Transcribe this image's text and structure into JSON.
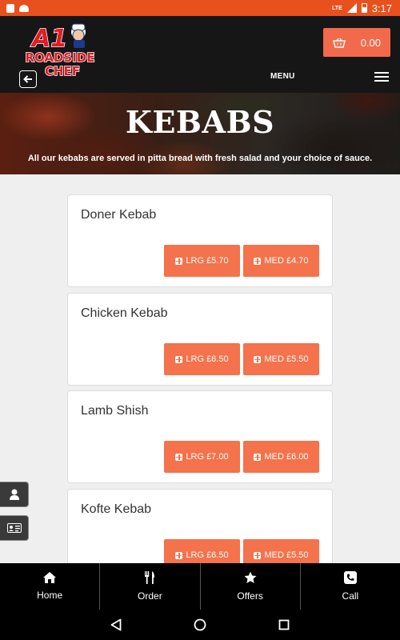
{
  "status_bar": {
    "time": "3:17",
    "network": "LTE"
  },
  "header": {
    "logo_line1": "A1",
    "logo_line2": "ROADSIDE",
    "logo_line3": "CHEF",
    "cart_total": "0.00",
    "menu_label": "MENU"
  },
  "hero": {
    "title": "KEBABS",
    "subtitle": "All our kebabs are served in pitta bread with fresh salad and your choice of sauce."
  },
  "items": [
    {
      "name": "Doner Kebab",
      "lrg": "LRG £5.70",
      "med": "MED £4.70"
    },
    {
      "name": "Chicken Kebab",
      "lrg": "LRG £6.50",
      "med": "MED £5.50"
    },
    {
      "name": "Lamb Shish",
      "lrg": "LRG £7.00",
      "med": "MED £6.00"
    },
    {
      "name": "Kofte Kebab",
      "lrg": "LRG £6.50",
      "med": "MED £5.50"
    }
  ],
  "bottom_nav": {
    "home": "Home",
    "order": "Order",
    "offers": "Offers",
    "call": "Call"
  },
  "colors": {
    "accent": "#f4724c",
    "status_bar": "#e8511d",
    "header_bg": "#161616"
  }
}
